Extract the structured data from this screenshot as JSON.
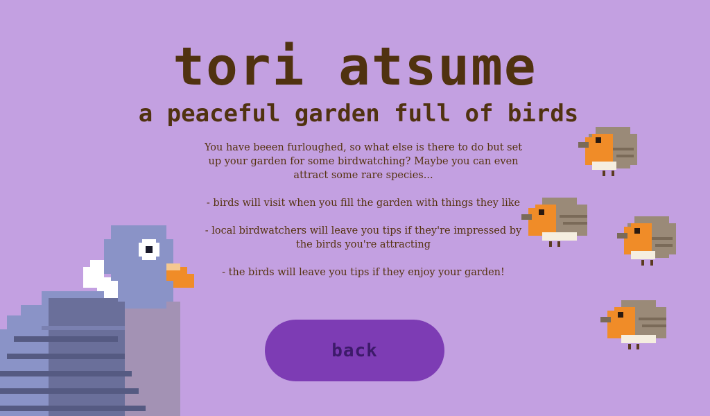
{
  "title": "tori atsume",
  "subtitle": "a peaceful garden full of birds",
  "description": {
    "intro": "You have beeen furloughed, so what else is there to do but set up your garden for some birdwatching? Maybe you can even attract some rare species...",
    "features": [
      "- birds will visit when you fill the garden with things they like",
      "- local birdwatchers will leave you tips if they're impressed by the birds you're attracting",
      "- the birds will leave you tips if they enjoy your garden!"
    ]
  },
  "back_button": {
    "label": "back"
  },
  "colors": {
    "background": "#c3a0e1",
    "text": "#503210",
    "button": "#7d3cb4",
    "button_text": "#3d1a6a"
  },
  "decorations": {
    "pigeon": "pigeon-sprite",
    "robins": [
      "robin-sprite",
      "robin-sprite",
      "robin-sprite",
      "robin-sprite"
    ]
  }
}
